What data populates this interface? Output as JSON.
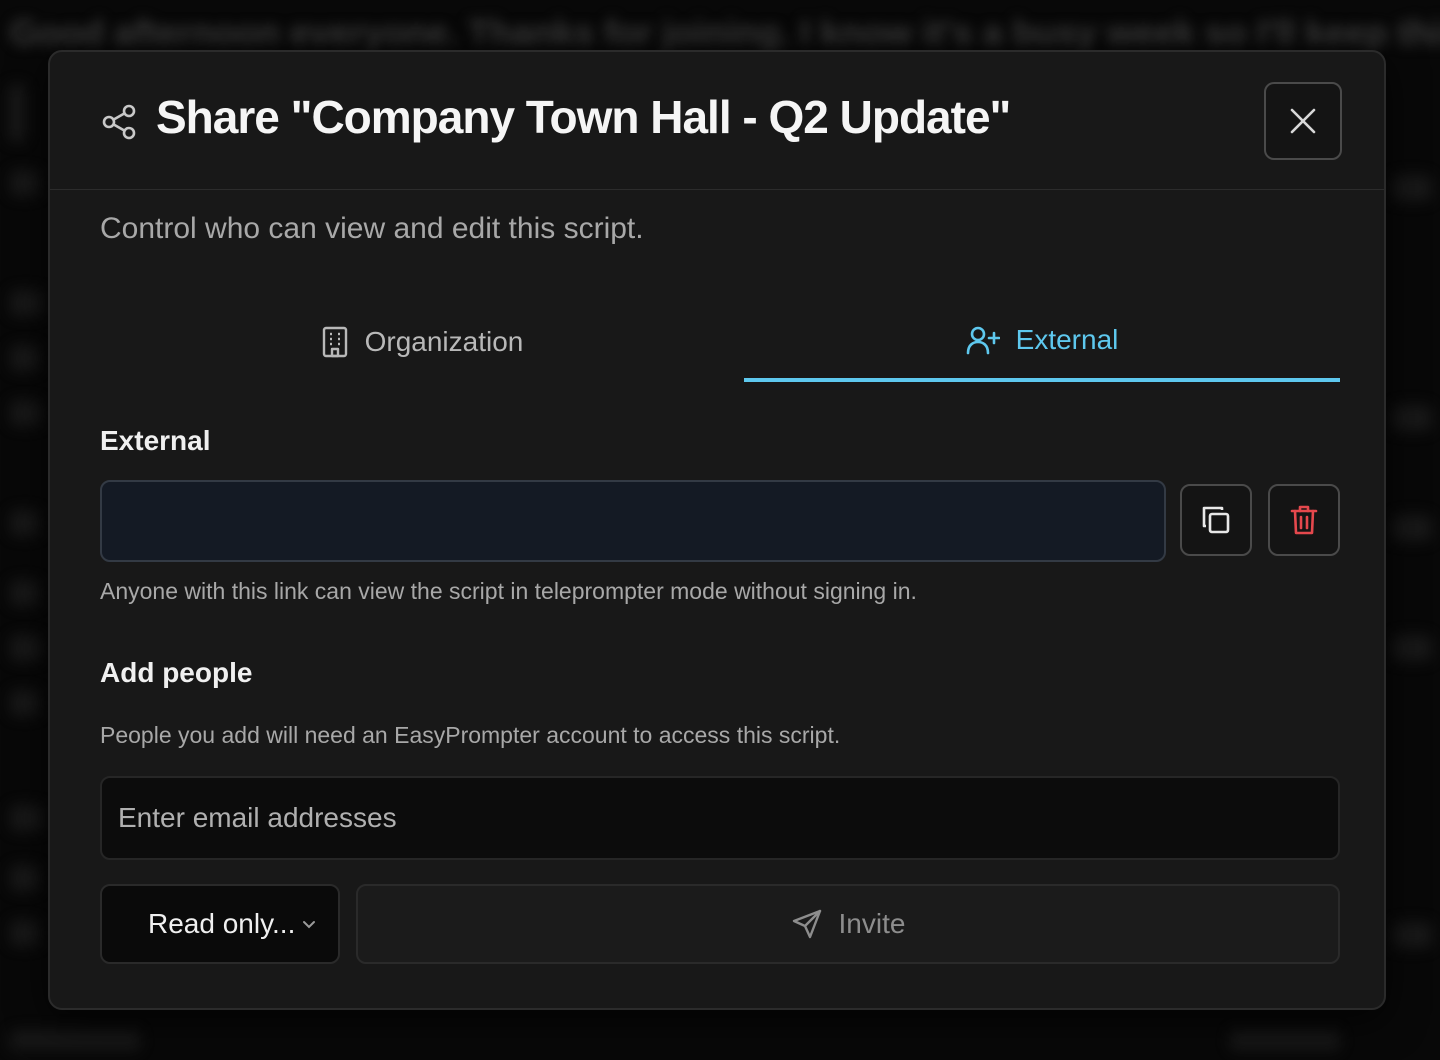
{
  "dialog": {
    "title": "Share \"Company Town Hall - Q2 Update\"",
    "subtitle": "Control who can view and edit this script."
  },
  "background": {
    "text": "Good afternoon everyone. Thanks for joining. I know it's a busy week so I'll keep this focused"
  },
  "tabs": [
    {
      "label": "Organization",
      "icon": "building-icon",
      "active": false
    },
    {
      "label": "External",
      "icon": "user-plus-icon",
      "active": true
    }
  ],
  "external": {
    "heading": "External",
    "link_value": "",
    "helper": "Anyone with this link can view the script in teleprompter mode without signing in."
  },
  "add_people": {
    "heading": "Add people",
    "helper": "People you add will need an EasyPrompter account to access this script.",
    "email_placeholder": "Enter email addresses",
    "permission_label": "Read only...",
    "invite_label": "Invite"
  },
  "colors": {
    "accent": "#5ec8ee",
    "danger": "#e5484d",
    "dialog_bg": "#181818"
  }
}
